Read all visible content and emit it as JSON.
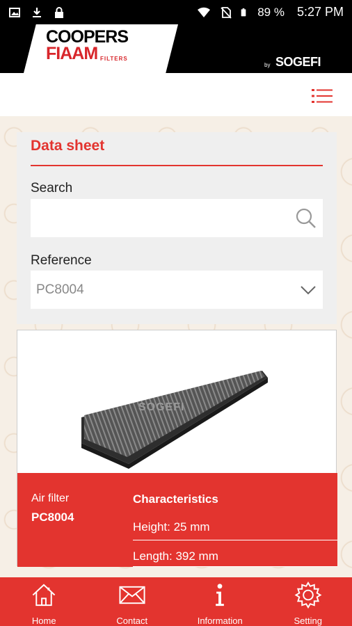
{
  "status_bar": {
    "battery": "89 %",
    "time": "5:27 PM",
    "icons": [
      "image-icon",
      "download-icon",
      "lock-icon",
      "wifi-icon",
      "no-sim-icon",
      "battery-icon"
    ]
  },
  "header": {
    "logo_line1": "COOPERS",
    "logo_line2": "FIAAM",
    "logo_sub": "FILTERS",
    "by": "by",
    "partner": "SOGEFI"
  },
  "datasheet": {
    "title": "Data sheet",
    "search_label": "Search",
    "search_value": "",
    "reference_label": "Reference",
    "reference_value": "PC8004"
  },
  "product": {
    "type": "Air filter",
    "code": "PC8004",
    "characteristics_title": "Characteristics",
    "height": "Height: 25 mm",
    "length": "Length: 392 mm",
    "image_watermark": "SOGEFI"
  },
  "bottom_nav": {
    "items": [
      {
        "label": "Home",
        "icon": "home-icon"
      },
      {
        "label": "Contact",
        "icon": "envelope-icon"
      },
      {
        "label": "Information",
        "icon": "info-icon"
      },
      {
        "label": "Setting",
        "icon": "gear-icon"
      }
    ]
  },
  "colors": {
    "accent": "#e3342f",
    "header_bg": "#000000"
  }
}
